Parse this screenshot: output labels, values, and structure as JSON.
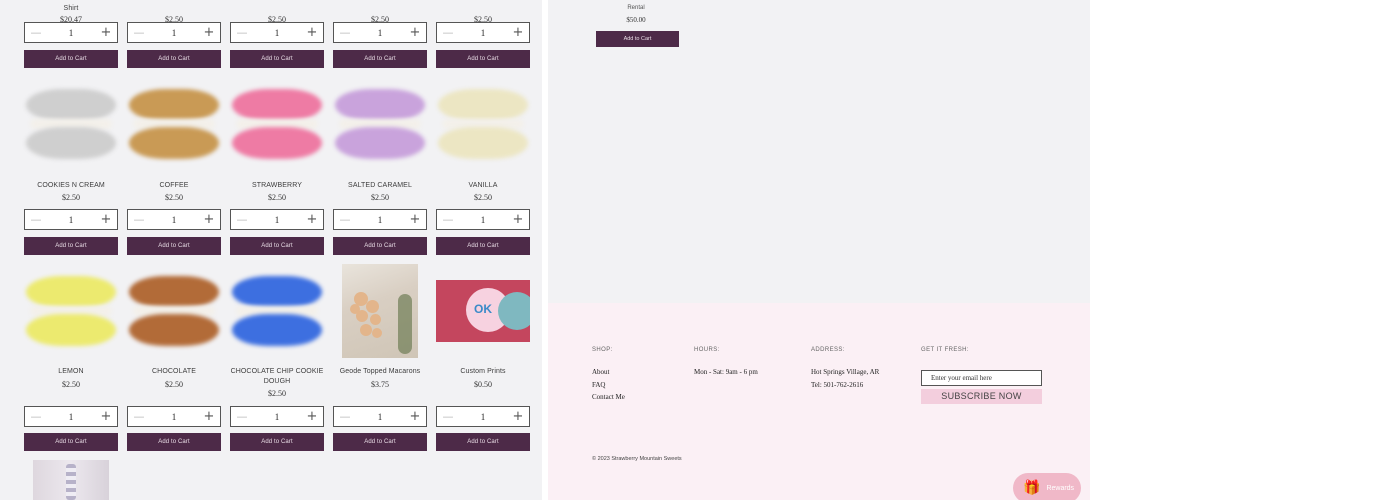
{
  "product_rows": [
    {
      "items": [
        {
          "title": "Shirt",
          "price": "$20.47",
          "qty": "1",
          "cart": "Add to Cart"
        },
        {
          "title": "",
          "price": "$2.50",
          "qty": "1",
          "cart": "Add to Cart"
        },
        {
          "title": "",
          "price": "$2.50",
          "qty": "1",
          "cart": "Add to Cart"
        },
        {
          "title": "",
          "price": "$2.50",
          "qty": "1",
          "cart": "Add to Cart"
        },
        {
          "title": "",
          "price": "$2.50",
          "qty": "1",
          "cart": "Add to Cart"
        }
      ]
    },
    {
      "items": [
        {
          "title": "COOKIES N CREAM",
          "price": "$2.50",
          "qty": "1",
          "cart": "Add to Cart",
          "color": "#cfcfcf"
        },
        {
          "title": "COFFEE",
          "price": "$2.50",
          "qty": "1",
          "cart": "Add to Cart",
          "color": "#c99a55"
        },
        {
          "title": "STRAWBERRY",
          "price": "$2.50",
          "qty": "1",
          "cart": "Add to Cart",
          "color": "#ee7ba4"
        },
        {
          "title": "SALTED CARAMEL",
          "price": "$2.50",
          "qty": "1",
          "cart": "Add to Cart",
          "color": "#c9a3dc"
        },
        {
          "title": "VANILLA",
          "price": "$2.50",
          "qty": "1",
          "cart": "Add to Cart",
          "color": "#ece6c3"
        }
      ]
    },
    {
      "items": [
        {
          "title": "LEMON",
          "price": "$2.50",
          "qty": "1",
          "cart": "Add to Cart",
          "color": "#ecea6f"
        },
        {
          "title": "CHOCOLATE",
          "price": "$2.50",
          "qty": "1",
          "cart": "Add to Cart",
          "color": "#b26b38"
        },
        {
          "title": "CHOCOLATE CHIP COOKIE DOUGH",
          "price": "$2.50",
          "qty": "1",
          "cart": "Add to Cart",
          "color": "#3d6fe0"
        },
        {
          "title": "Geode Topped Macarons",
          "price": "$3.75",
          "qty": "1",
          "cart": "Add to Cart"
        },
        {
          "title": "Custom Prints",
          "price": "$0.50",
          "qty": "1",
          "cart": "Add to Cart"
        }
      ]
    }
  ],
  "rental": {
    "title": "Rental",
    "price": "$50.00",
    "cart": "Add to Cart"
  },
  "footer": {
    "shop_heading": "SHOP:",
    "shop_links": [
      "About",
      "FAQ",
      "Contact Me"
    ],
    "hours_heading": "HOURS:",
    "hours": "Mon - Sat: 9am - 6 pm",
    "address_heading": "ADDRESS:",
    "address": "Hot Springs Village, AR",
    "tel": "Tel: 501-762-2616",
    "fresh_heading": "GET IT FRESH:",
    "email_placeholder": "Enter your email here",
    "subscribe": "SUBSCRIBE NOW",
    "copyright": "© 2023 Strawberry Mountain Sweets",
    "rewards": "Rewards"
  },
  "icons": {
    "minus": "minus-icon",
    "plus": "plus-icon",
    "gift": "gift-icon"
  }
}
